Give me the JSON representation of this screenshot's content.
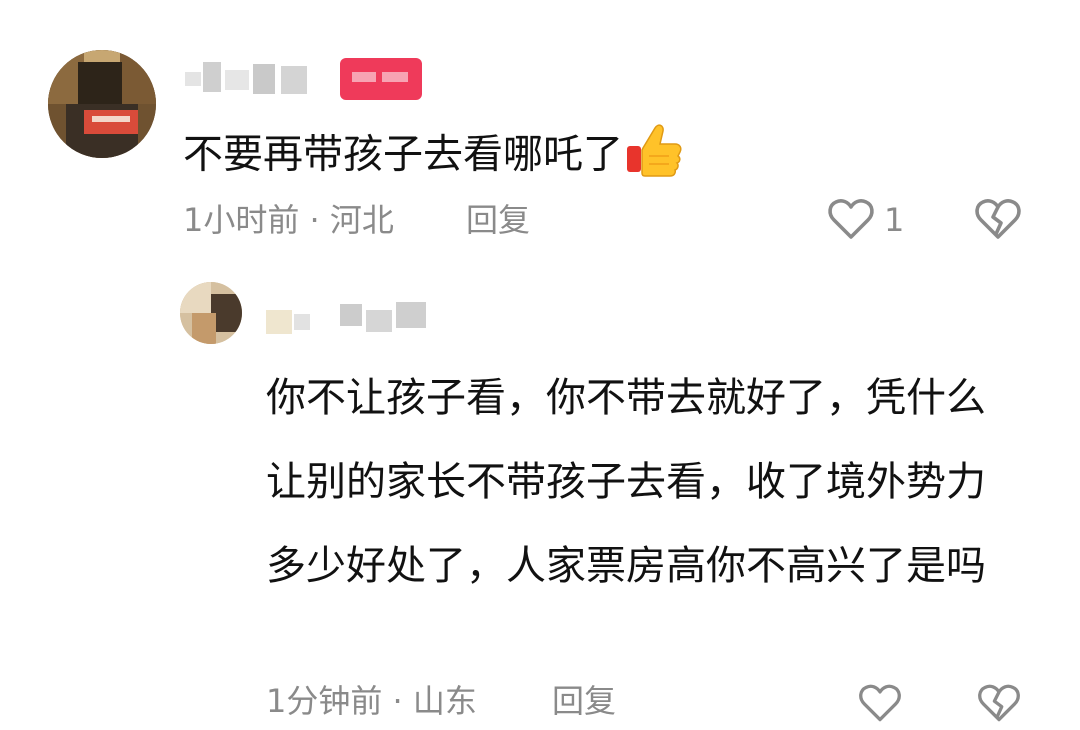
{
  "comments": [
    {
      "text": "不要再带孩子去看哪吒了",
      "emoji": "thumbs-up",
      "meta": "1小时前 · 河北",
      "reply_label": "回复",
      "like_count": "1"
    },
    {
      "text": "你不让孩子看，你不带去就好了，凭什么让别的家长不带孩子去看，收了境外势力多少好处了，人家票房高你不高兴了是吗",
      "meta": "1分钟前 · 山东",
      "reply_label": "回复"
    }
  ],
  "colors": {
    "badge": "#ef3a5a",
    "meta_text": "#8a8a8a",
    "body_text": "#111111"
  }
}
